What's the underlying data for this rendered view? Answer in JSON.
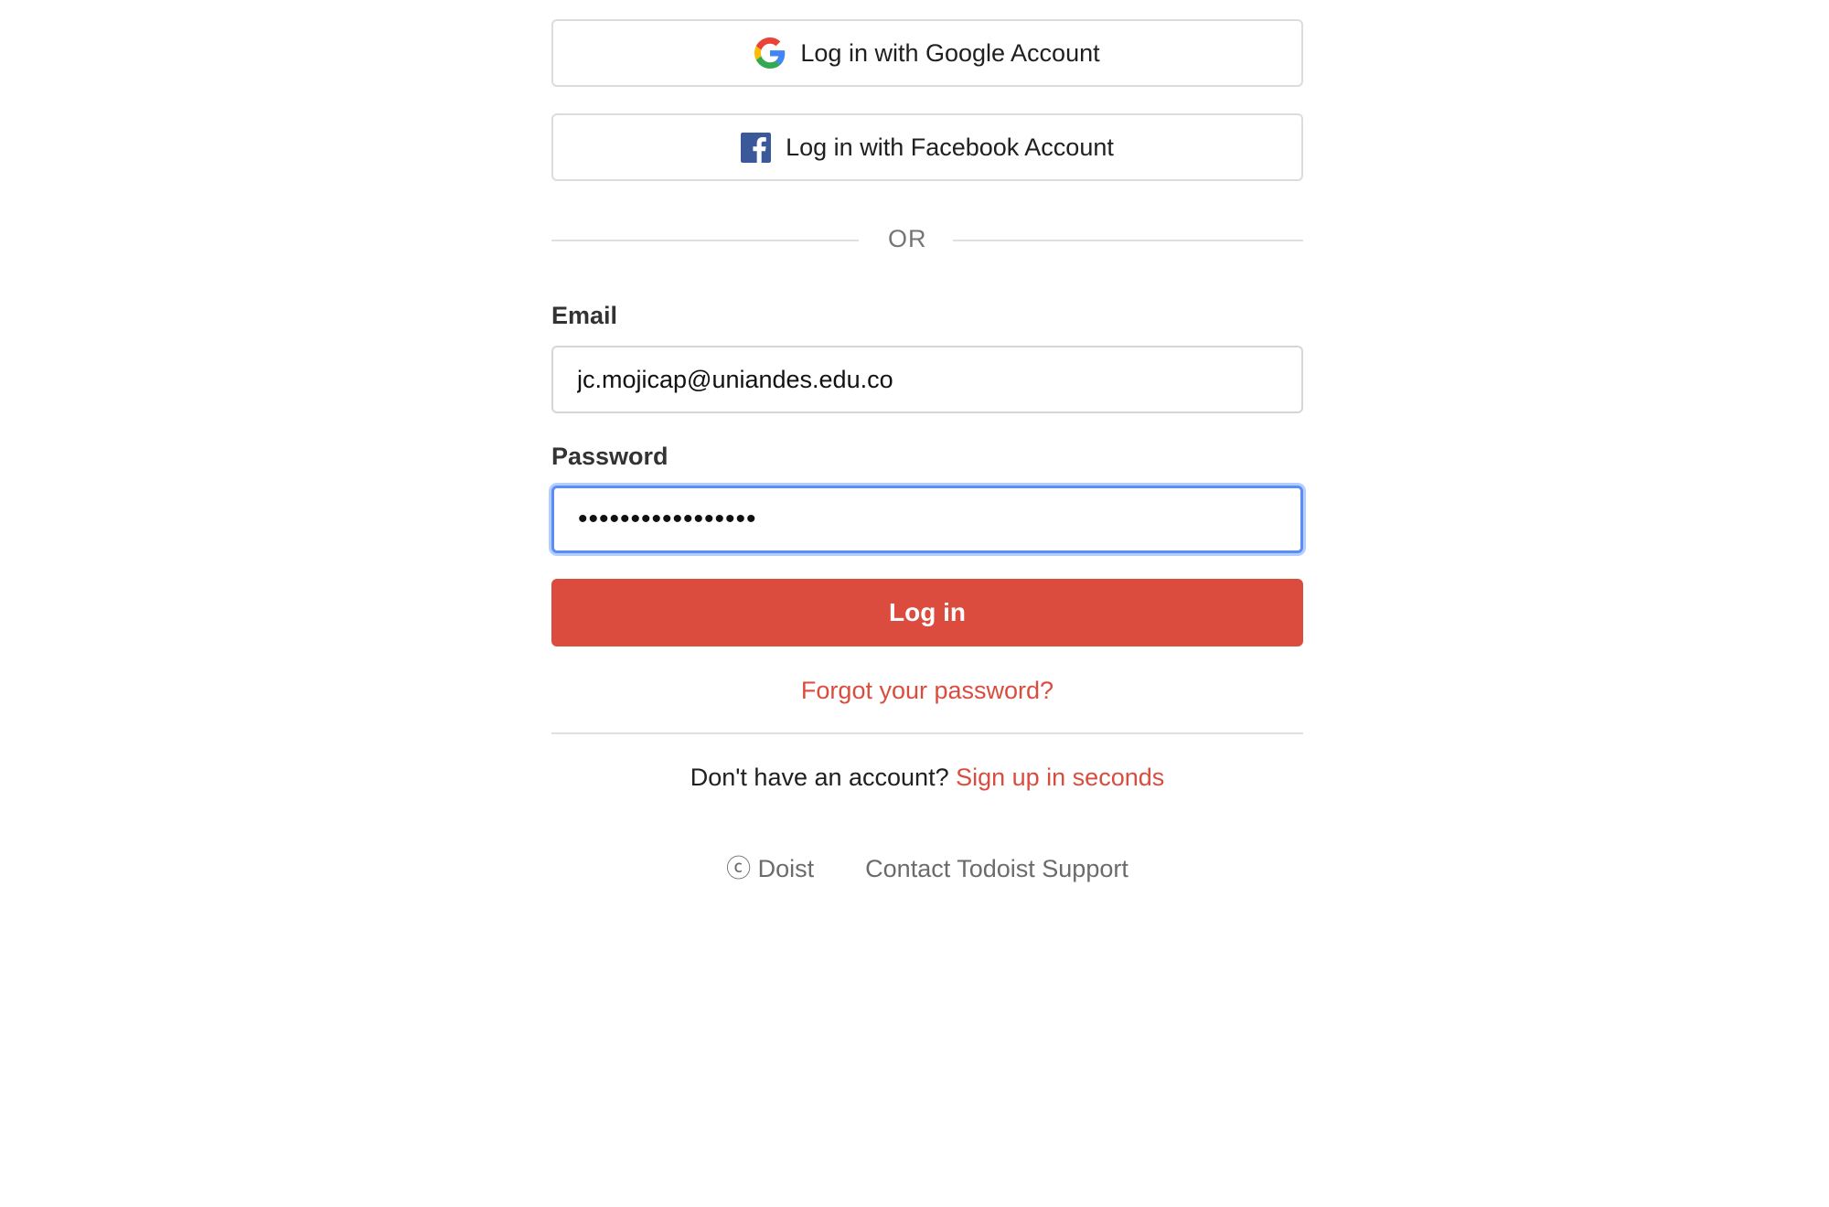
{
  "social": {
    "google_label": "Log in with Google Account",
    "facebook_label": "Log in with Facebook Account"
  },
  "separator": {
    "or_text": "OR"
  },
  "form": {
    "email_label": "Email",
    "email_value": "jc.mojicap@uniandes.edu.co",
    "password_label": "Password",
    "password_value": "•••••••••••••••••",
    "submit_label": "Log in",
    "forgot_label": "Forgot your password?"
  },
  "signup": {
    "prompt": "Don't have an account?",
    "link_label": "Sign up in seconds"
  },
  "footer": {
    "copyright": "ⓒ Doist",
    "support": "Contact Todoist Support"
  },
  "colors": {
    "brand_red": "#db4c3f",
    "focus_blue": "#5b8ef5",
    "facebook_blue": "#3b5998"
  },
  "icons": {
    "google": "google-icon",
    "facebook": "facebook-icon"
  }
}
